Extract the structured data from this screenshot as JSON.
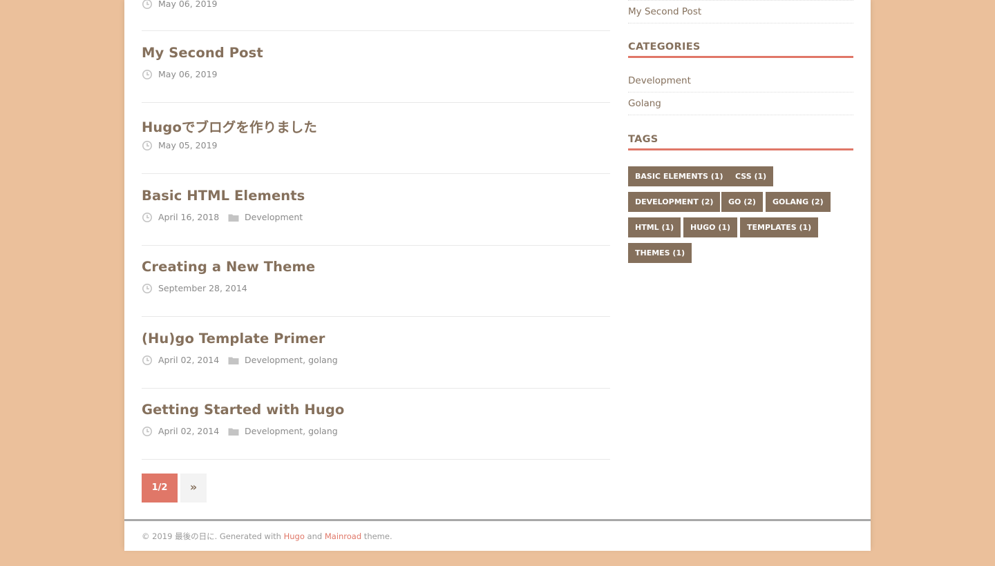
{
  "posts": [
    {
      "title": "",
      "date": "May 06, 2019",
      "categories": []
    },
    {
      "title": "My Second Post",
      "date": "May 06, 2019",
      "categories": []
    },
    {
      "title": "Hugoでブログを作りました",
      "date": "May 05, 2019",
      "categories": []
    },
    {
      "title": "Basic HTML Elements",
      "date": "April 16, 2018",
      "categories": [
        "Development"
      ]
    },
    {
      "title": "Creating a New Theme",
      "date": "September 28, 2014",
      "categories": []
    },
    {
      "title": "(Hu)go Template Primer",
      "date": "April 02, 2014",
      "categories": [
        "Development",
        "golang"
      ]
    },
    {
      "title": "Getting Started with Hugo",
      "date": "April 02, 2014",
      "categories": [
        "Development",
        "golang"
      ]
    }
  ],
  "category_separator": ", ",
  "pagination": {
    "current": "1/2",
    "next": "»"
  },
  "sidebar": {
    "recent_posts": [
      "My Second Post"
    ],
    "categories_title": "CATEGORIES",
    "categories": [
      "Development",
      "Golang"
    ],
    "tags_title": "TAGS",
    "tags": [
      "BASIC ELEMENTS (1)",
      "CSS (1)",
      "DEVELOPMENT (2)",
      "GO (2)",
      "GOLANG (2)",
      "HTML (1)",
      "HUGO (1)",
      "TEMPLATES (1)",
      "THEMES (1)"
    ]
  },
  "footer": {
    "copyright": "© 2019 最後の日に. Generated with ",
    "hugo_link": "Hugo",
    "and": " and ",
    "theme_link": "Mainroad",
    "suffix": " theme."
  },
  "colors": {
    "page_background": "#ebc09b",
    "accent": "#e07768",
    "title_brown": "#85705c",
    "meta_gray": "#8a8a8a"
  },
  "icons": {
    "date": "clock-icon",
    "category": "folder-icon"
  }
}
